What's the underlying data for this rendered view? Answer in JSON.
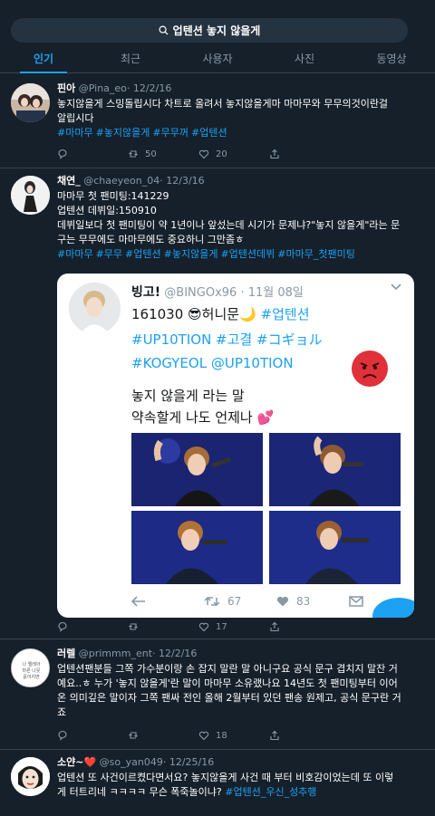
{
  "search": {
    "query": "업텐션 놓지 않을게"
  },
  "tabs": [
    "인기",
    "최근",
    "사용자",
    "사진",
    "동영상"
  ],
  "tweets": [
    {
      "name": "핀아",
      "handle": "@Pina_eo",
      "date": "· 12/2/16",
      "lines": [
        "놓지않을게 스밍돌립시다 차트로 올려서 놓지않을게마 마마무와 무무의것이란걸",
        "알립시다"
      ],
      "tags": [
        "#마마무",
        "#놓지않을게",
        "#무무꺼",
        "#업텐션"
      ],
      "reply_count": "",
      "retweet_count": "50",
      "like_count": "20"
    },
    {
      "name": "채연_",
      "handle": "@chaeyeon_04",
      "date": "· 12/3/16",
      "lines": [
        "마마무 첫 팬미팅:141229",
        "업텐션 데뷔일:150910",
        "데뷔일보다 첫 팬미팅이 약 1년이나 앞섰는데 시기가 문제냐?\"놓지 않을게\"라는 문",
        "구는 무무에도 마마무에도 중요하니 그만좀ㅎ"
      ],
      "tags": [
        "#마마무",
        "#무무",
        "#업텐션",
        "#놓지않을게",
        "#업텐션데뷔",
        "#마마무_첫팬미팅"
      ],
      "reply_count": "",
      "retweet_count": "",
      "like_count": "17"
    },
    {
      "name": "러렐",
      "handle": "@primmm_ent",
      "date": "· 12/2/16",
      "lines": [
        "업텐션팬분들 그쪽 가수분이랑 손 잡지 말란 말 아니구요 공식 문구 겹치지 말잔 거",
        "예요..ㅎ 누가 '놓지 않을게'란 말이 마마무 소유랬나요 14년도 첫 팬미팅부터 이어",
        "온 의미깊은 말이자 그쪽 팬싸 전인 올해 2월부터 있던 팬송 원제고, 공식 문구란 거",
        "죠"
      ],
      "tags": [],
      "reply_count": "",
      "retweet_count": "",
      "like_count": "18"
    },
    {
      "name": "소얀~❤️",
      "handle": "@so_yan049",
      "date": "· 12/25/16",
      "lines": [
        "업텐션 또 사건이르켰다면서요? 놓지않을게 사건 때 부터 비호감이었는데 또 이렇",
        "게 터트리네 ㅋㅋㅋㅋ 무슨 폭죽놀이냐?"
      ],
      "inline_tag": "#업텐션_우신_성추행",
      "tags": []
    }
  ],
  "quoted_card": {
    "name": "빙고!",
    "handle": "@BINGOx96",
    "date": "· 11월 08일",
    "line1_prefix": "161030 😎허니문🌙",
    "line1_tag": "#업텐션",
    "line2": "#UP10TION #고결 #コギョル",
    "line3": "#KOGYEOL @UP10TION",
    "text1": "놓지 않을게 라는 말",
    "text2": "약속할게 나도 언제나 💕",
    "retweet_count": "67",
    "like_count": "83"
  },
  "colors": {
    "background": "#15202b",
    "accent": "#1da1f2",
    "muted": "#8899a6",
    "divider": "#38444d"
  }
}
